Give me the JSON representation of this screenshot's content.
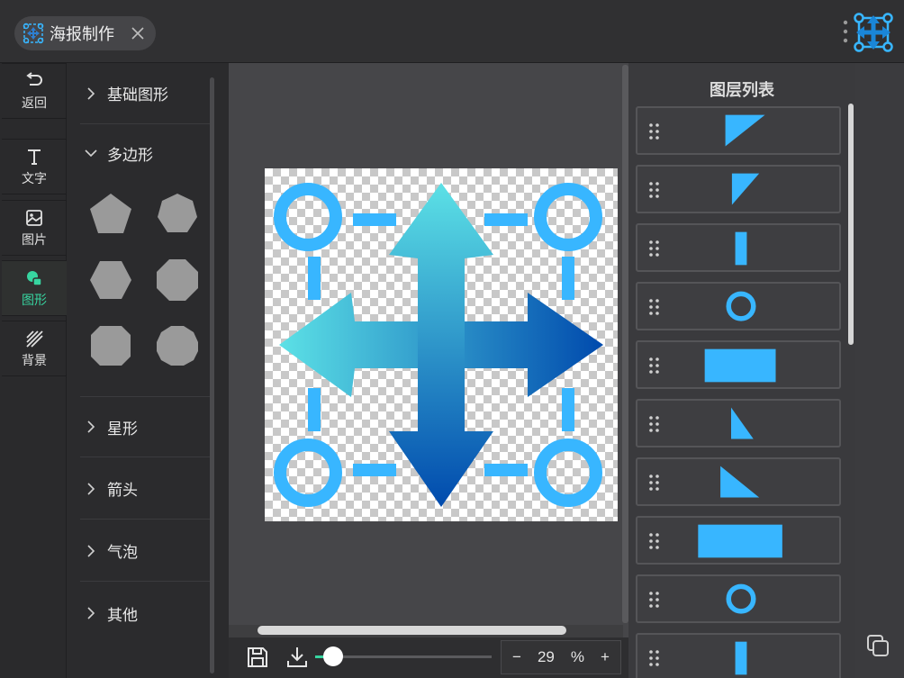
{
  "header": {
    "tab_title": "海报制作",
    "close_icon": "close-icon",
    "logo_icon": "move-arrows-logo"
  },
  "rail": {
    "items": [
      {
        "label": "返回",
        "icon": "undo-icon"
      },
      {
        "label": "文字",
        "icon": "text-icon"
      },
      {
        "label": "图片",
        "icon": "image-icon"
      },
      {
        "label": "图形",
        "icon": "shapes-icon",
        "active": true
      },
      {
        "label": "背景",
        "icon": "hatch-icon"
      }
    ]
  },
  "categories": {
    "items": [
      {
        "label": "基础图形",
        "expanded": false
      },
      {
        "label": "多边形",
        "expanded": true
      },
      {
        "label": "星形",
        "expanded": false
      },
      {
        "label": "箭头",
        "expanded": false
      },
      {
        "label": "气泡",
        "expanded": false
      },
      {
        "label": "其他",
        "expanded": false
      }
    ],
    "polygons": [
      "pentagon",
      "heptagon",
      "hexagon",
      "octagon",
      "nonagon",
      "decagon"
    ]
  },
  "zoom": {
    "value": "29",
    "unit": "%",
    "minus": "−",
    "plus": "+",
    "slider_fraction": 0.1
  },
  "layers": {
    "title": "图层列表",
    "items": [
      {
        "shape": "triangle-large"
      },
      {
        "shape": "triangle-small"
      },
      {
        "shape": "bar-vertical"
      },
      {
        "shape": "ring"
      },
      {
        "shape": "rectangle"
      },
      {
        "shape": "right-triangle-small"
      },
      {
        "shape": "right-triangle"
      },
      {
        "shape": "rectangle-wide"
      },
      {
        "shape": "ring"
      },
      {
        "shape": "bar-vertical"
      }
    ]
  },
  "colors": {
    "accent": "#37d5a0",
    "shape_blue": "#38b6ff",
    "gradient_start": "#5ce1e6",
    "gradient_end": "#004aad"
  }
}
